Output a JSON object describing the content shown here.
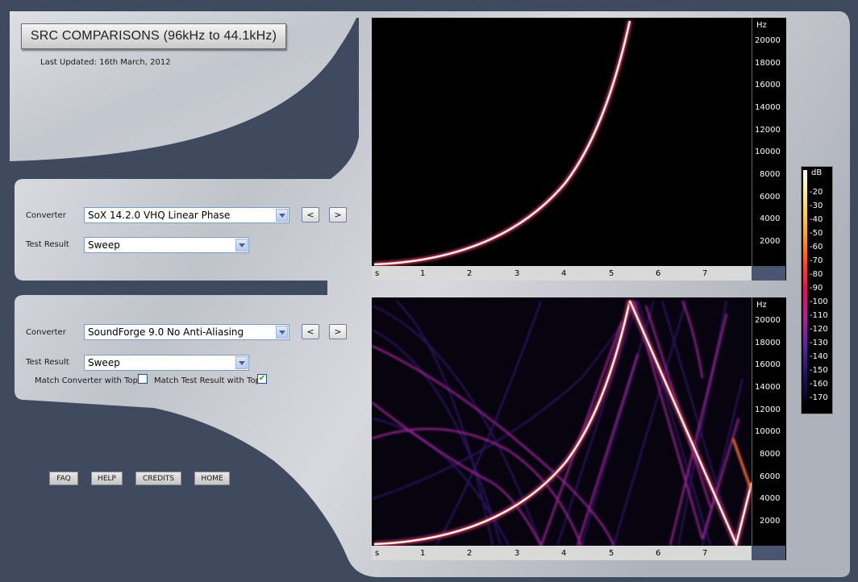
{
  "header": {
    "title": "SRC COMPARISONS (96kHz to 44.1kHz)",
    "updated": "Last Updated: 16th March, 2012"
  },
  "top_panel": {
    "converter_label": "Converter",
    "converter_value": "SoX 14.2.0 VHQ Linear Phase",
    "test_label": "Test Result",
    "test_value": "Sweep",
    "prev": "<",
    "next": ">"
  },
  "bottom_panel": {
    "converter_label": "Converter",
    "converter_value": "SoundForge 9.0 No Anti-Aliasing",
    "test_label": "Test Result",
    "test_value": "Sweep",
    "prev": "<",
    "next": ">",
    "match_converter_label": "Match Converter with Top",
    "match_converter_checked": false,
    "match_test_label": "Match Test Result with Top",
    "match_test_checked": true
  },
  "footer_links": [
    "FAQ",
    "HELP",
    "CREDITS",
    "HOME"
  ],
  "spectrogram": {
    "y_unit": "Hz",
    "y_ticks": [
      "20000",
      "18000",
      "16000",
      "14000",
      "12000",
      "10000",
      "8000",
      "6000",
      "4000",
      "2000"
    ],
    "x_ticks": [
      "s",
      "1",
      "2",
      "3",
      "4",
      "5",
      "6",
      "7"
    ]
  },
  "db_scale": {
    "unit": "dB",
    "ticks": [
      "-20",
      "-30",
      "-40",
      "-50",
      "-60",
      "-70",
      "-80",
      "-90",
      "-100",
      "-110",
      "-120",
      "-130",
      "-140",
      "-150",
      "-160",
      "-170"
    ]
  },
  "colors": {
    "background": "#3f4a5e",
    "sweep": "#fff3d6",
    "alias": "#b0269e"
  }
}
